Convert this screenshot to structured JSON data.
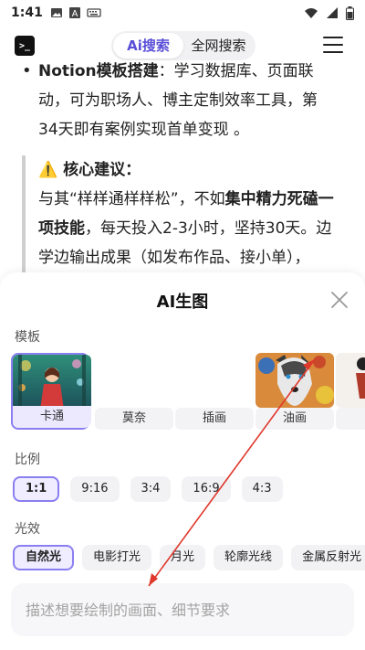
{
  "status_bar": {
    "time": "1:41"
  },
  "header": {
    "tabs": [
      {
        "label": "Ai搜索",
        "active": true
      },
      {
        "label": "全网搜索",
        "active": false
      }
    ]
  },
  "article": {
    "bullet_title": "Notion模板搭建",
    "bullet_line1": "：学习数据库、页面联",
    "bullet_line2": "动，可为职场人、博主定制效率工具，第",
    "bullet_line3": "34天即有案例实现首单变现 。",
    "quote_title": "⚠️ 核心建议：",
    "quote_line1_a": "与其“样样通样样松”，不如",
    "quote_line1_b": "集中精力死磕一",
    "quote_line2_a": "项技能",
    "quote_line2_b": "，每天投入2-3小时，坚持30天。边",
    "quote_line3": "学边输出成果（如发布作品、接小单），"
  },
  "sheet": {
    "title": "AI生图",
    "template_label": "模板",
    "templates": [
      {
        "label": "卡通",
        "selected": true
      },
      {
        "label": "莫奈",
        "selected": false
      },
      {
        "label": "插画",
        "selected": false
      },
      {
        "label": "油画",
        "selected": false
      }
    ],
    "ratio_label": "比例",
    "ratios": [
      {
        "label": "1:1",
        "selected": true
      },
      {
        "label": "9:16",
        "selected": false
      },
      {
        "label": "3:4",
        "selected": false
      },
      {
        "label": "16:9",
        "selected": false
      },
      {
        "label": "4:3",
        "selected": false
      }
    ],
    "light_label": "光效",
    "lights": [
      {
        "label": "自然光",
        "selected": true
      },
      {
        "label": "电影打光",
        "selected": false
      },
      {
        "label": "月光",
        "selected": false
      },
      {
        "label": "轮廓光线",
        "selected": false
      },
      {
        "label": "金属反射光",
        "selected": false
      }
    ],
    "prompt_placeholder": "描述想要绘制的画面、细节要求"
  },
  "colors": {
    "accent": "#5a4fd8",
    "selected_border": "#8a7ff0",
    "annotation_arrow": "#e0392b"
  }
}
